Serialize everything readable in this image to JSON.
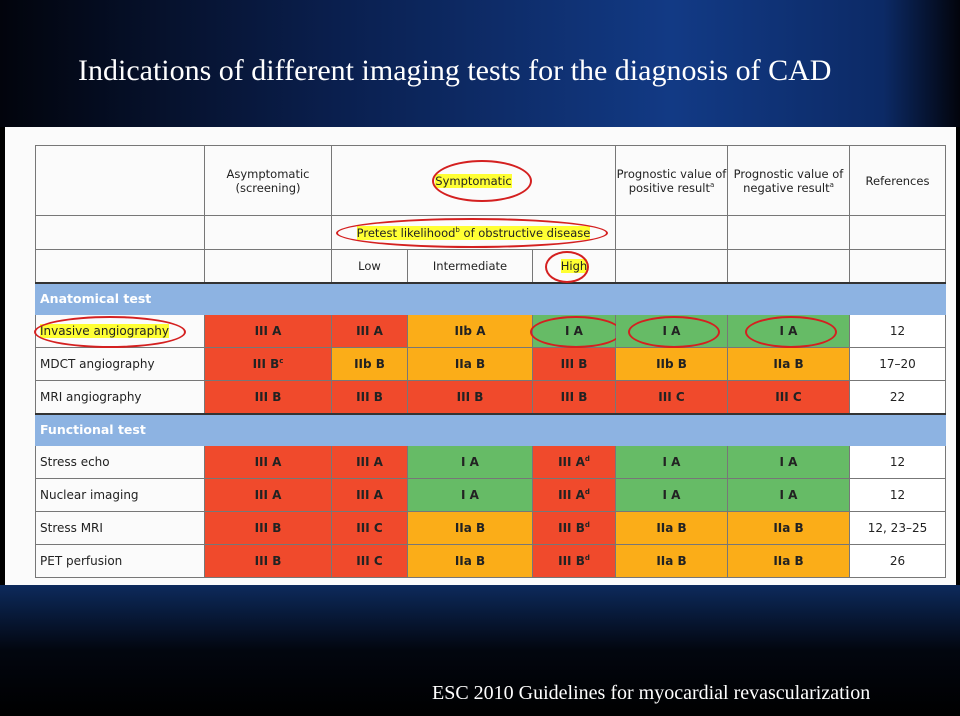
{
  "title": "Indications of different imaging tests for the diagnosis of CAD",
  "footer": "ESC 2010 Guidelines for myocardial revascularization",
  "colors": {
    "red": "#f04a2c",
    "orange": "#fbad18",
    "green": "#66bb66",
    "section": "#8db3e2",
    "highlight": "#ffff33",
    "circle": "#d42020"
  },
  "header": {
    "asymptomatic": "Asymptomatic (screening)",
    "symptomatic": "Symptomatic",
    "positive": "Prognostic value of positive result",
    "positive_sup": "a",
    "negative": "Prognostic value of negative result",
    "negative_sup": "a",
    "references": "References",
    "pretest": "Pretest likelihood",
    "pretest_sup": "b",
    "pretest_rest": " of obstructive disease",
    "low": "Low",
    "intermediate": "Intermediate",
    "high": "High"
  },
  "sections": [
    {
      "title": "Anatomical test",
      "rows": [
        {
          "label": "Invasive angiography",
          "highlight": true,
          "cells": [
            {
              "t": "III A",
              "c": "red"
            },
            {
              "t": "III A",
              "c": "red"
            },
            {
              "t": "IIb A",
              "c": "orange"
            },
            {
              "t": "I A",
              "c": "green",
              "circled": true
            },
            {
              "t": "I A",
              "c": "green",
              "circled": true
            },
            {
              "t": "I A",
              "c": "green",
              "circled": true
            }
          ],
          "ref": "12"
        },
        {
          "label": "MDCT angiography",
          "cells": [
            {
              "t": "III B",
              "s": "c",
              "c": "red"
            },
            {
              "t": "IIb B",
              "c": "orange"
            },
            {
              "t": "IIa B",
              "c": "orange"
            },
            {
              "t": "III B",
              "c": "red"
            },
            {
              "t": "IIb B",
              "c": "orange"
            },
            {
              "t": "IIa B",
              "c": "orange"
            }
          ],
          "ref": "17–20"
        },
        {
          "label": "MRI angiography",
          "cells": [
            {
              "t": "III B",
              "c": "red"
            },
            {
              "t": "III B",
              "c": "red"
            },
            {
              "t": "III B",
              "c": "red"
            },
            {
              "t": "III B",
              "c": "red"
            },
            {
              "t": "III C",
              "c": "red"
            },
            {
              "t": "III C",
              "c": "red"
            }
          ],
          "ref": "22"
        }
      ]
    },
    {
      "title": "Functional test",
      "rows": [
        {
          "label": "Stress echo",
          "cells": [
            {
              "t": "III A",
              "c": "red"
            },
            {
              "t": "III A",
              "c": "red"
            },
            {
              "t": "I A",
              "c": "green"
            },
            {
              "t": "III A",
              "s": "d",
              "c": "red"
            },
            {
              "t": "I A",
              "c": "green"
            },
            {
              "t": "I A",
              "c": "green"
            }
          ],
          "ref": "12"
        },
        {
          "label": "Nuclear imaging",
          "cells": [
            {
              "t": "III A",
              "c": "red"
            },
            {
              "t": "III A",
              "c": "red"
            },
            {
              "t": "I A",
              "c": "green"
            },
            {
              "t": "III A",
              "s": "d",
              "c": "red"
            },
            {
              "t": "I A",
              "c": "green"
            },
            {
              "t": "I A",
              "c": "green"
            }
          ],
          "ref": "12"
        },
        {
          "label": "Stress MRI",
          "cells": [
            {
              "t": "III B",
              "c": "red"
            },
            {
              "t": "III C",
              "c": "red"
            },
            {
              "t": "IIa B",
              "c": "orange"
            },
            {
              "t": "III B",
              "s": "d",
              "c": "red"
            },
            {
              "t": "IIa B",
              "c": "orange"
            },
            {
              "t": "IIa B",
              "c": "orange"
            }
          ],
          "ref": "12, 23–25"
        },
        {
          "label": "PET perfusion",
          "cells": [
            {
              "t": "III B",
              "c": "red"
            },
            {
              "t": "III C",
              "c": "red"
            },
            {
              "t": "IIa B",
              "c": "orange"
            },
            {
              "t": "III B",
              "s": "d",
              "c": "red"
            },
            {
              "t": "IIa B",
              "c": "orange"
            },
            {
              "t": "IIa B",
              "c": "orange"
            }
          ],
          "ref": "26"
        }
      ]
    }
  ]
}
